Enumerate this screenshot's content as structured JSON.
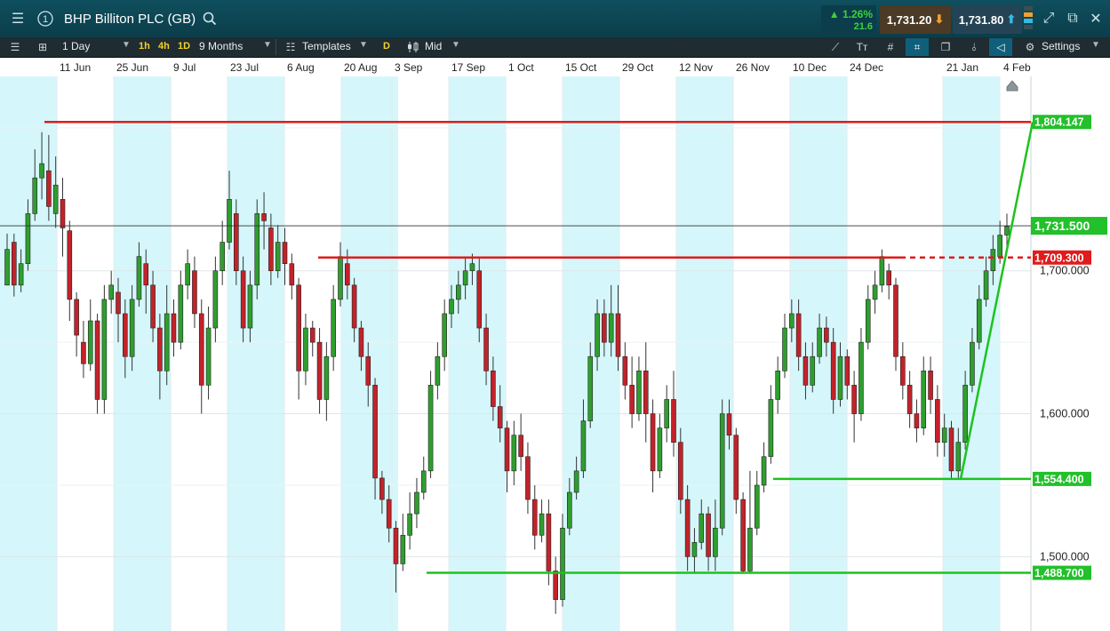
{
  "header": {
    "menu_icon": "hamburger-icon",
    "slot_number": "1",
    "title": "BHP Billiton PLC (GB)",
    "search_icon": "search-icon",
    "change_pct": "▲ 1.26%",
    "change_abs": "21.6",
    "sell_price": "1,731.20",
    "buy_price": "1,731.80",
    "colors": {
      "up": "#3ad43a",
      "sell_bg": "#4a3a26",
      "buy_bg": "#244455"
    }
  },
  "toolbar": {
    "interval": "1 Day",
    "quick_intervals": [
      "1h",
      "4h",
      "1D"
    ],
    "range": "9 Months",
    "templates": "Templates",
    "d_label": "D",
    "price_type": "Mid",
    "settings": "Settings"
  },
  "dates": [
    "11 Jun",
    "25 Jun",
    "9 Jul",
    "23 Jul",
    "6 Aug",
    "20 Aug",
    "3 Sep",
    "17 Sep",
    "1 Oct",
    "15 Oct",
    "29 Oct",
    "12 Nov",
    "26 Nov",
    "10 Dec",
    "24 Dec",
    "21 Jan",
    "4 Feb"
  ],
  "chart_data": {
    "type": "candlestick",
    "y_ticks": [
      "1,700.000",
      "1,600.000",
      "1,500.000"
    ],
    "y_tick_values": [
      1700,
      1600,
      1500
    ],
    "ylim": [
      1448,
      1836
    ],
    "current_price": "1,731.500",
    "current_value": 1731.5,
    "levels": [
      {
        "label": "1,804.147",
        "value": 1804.147,
        "color": "#e01b1b",
        "badge_color": "#22c02a"
      },
      {
        "label": "1,709.300",
        "value": 1709.3,
        "color": "#e01b1b",
        "badge_color": "#e01b1b"
      },
      {
        "label": "1,554.400",
        "value": 1554.4,
        "color": "#1ec21e",
        "badge_color": "#22c02a"
      },
      {
        "label": "1,488.700",
        "value": 1488.7,
        "color": "#1ec21e",
        "badge_color": "#22c02a"
      }
    ],
    "trend_line": {
      "from_value": 1554.4,
      "to_value": 1804.147,
      "color": "#1ec21e"
    },
    "candles": [
      [
        1690,
        1715,
        1700,
        1726
      ],
      [
        1720,
        1690,
        1682,
        1726
      ],
      [
        1690,
        1705,
        1685,
        1715
      ],
      [
        1705,
        1740,
        1700,
        1750
      ],
      [
        1740,
        1765,
        1735,
        1785
      ],
      [
        1765,
        1775,
        1750,
        1797
      ],
      [
        1770,
        1745,
        1735,
        1795
      ],
      [
        1740,
        1760,
        1730,
        1780
      ],
      [
        1750,
        1730,
        1710,
        1765
      ],
      [
        1728,
        1680,
        1665,
        1735
      ],
      [
        1680,
        1655,
        1640,
        1685
      ],
      [
        1650,
        1635,
        1625,
        1665
      ],
      [
        1635,
        1665,
        1630,
        1680
      ],
      [
        1665,
        1610,
        1600,
        1670
      ],
      [
        1610,
        1680,
        1600,
        1690
      ],
      [
        1680,
        1690,
        1670,
        1700
      ],
      [
        1685,
        1670,
        1650,
        1695
      ],
      [
        1670,
        1640,
        1625,
        1680
      ],
      [
        1640,
        1680,
        1630,
        1690
      ],
      [
        1680,
        1710,
        1675,
        1720
      ],
      [
        1705,
        1690,
        1670,
        1715
      ],
      [
        1690,
        1660,
        1650,
        1700
      ],
      [
        1660,
        1630,
        1610,
        1670
      ],
      [
        1630,
        1670,
        1620,
        1690
      ],
      [
        1670,
        1650,
        1640,
        1680
      ],
      [
        1650,
        1690,
        1645,
        1700
      ],
      [
        1690,
        1705,
        1680,
        1715
      ],
      [
        1700,
        1670,
        1660,
        1710
      ],
      [
        1670,
        1620,
        1600,
        1680
      ],
      [
        1620,
        1660,
        1610,
        1675
      ],
      [
        1660,
        1700,
        1650,
        1710
      ],
      [
        1700,
        1720,
        1690,
        1735
      ],
      [
        1720,
        1750,
        1715,
        1770
      ],
      [
        1740,
        1700,
        1690,
        1750
      ],
      [
        1700,
        1660,
        1650,
        1710
      ],
      [
        1660,
        1690,
        1650,
        1700
      ],
      [
        1690,
        1740,
        1680,
        1750
      ],
      [
        1740,
        1735,
        1715,
        1755
      ],
      [
        1730,
        1700,
        1690,
        1740
      ],
      [
        1700,
        1720,
        1695,
        1732
      ],
      [
        1720,
        1705,
        1690,
        1730
      ],
      [
        1705,
        1690,
        1680,
        1712
      ],
      [
        1690,
        1630,
        1610,
        1695
      ],
      [
        1630,
        1660,
        1620,
        1670
      ],
      [
        1660,
        1650,
        1640,
        1665
      ],
      [
        1650,
        1610,
        1600,
        1660
      ],
      [
        1610,
        1640,
        1595,
        1650
      ],
      [
        1640,
        1680,
        1630,
        1690
      ],
      [
        1680,
        1710,
        1675,
        1720
      ],
      [
        1705,
        1690,
        1680,
        1715
      ],
      [
        1690,
        1660,
        1650,
        1695
      ],
      [
        1660,
        1640,
        1630,
        1665
      ],
      [
        1640,
        1620,
        1605,
        1650
      ],
      [
        1620,
        1555,
        1540,
        1625
      ],
      [
        1555,
        1540,
        1530,
        1560
      ],
      [
        1540,
        1520,
        1510,
        1550
      ],
      [
        1520,
        1495,
        1475,
        1525
      ],
      [
        1495,
        1515,
        1490,
        1530
      ],
      [
        1515,
        1530,
        1505,
        1545
      ],
      [
        1530,
        1545,
        1520,
        1555
      ],
      [
        1545,
        1560,
        1540,
        1570
      ],
      [
        1560,
        1620,
        1555,
        1630
      ],
      [
        1620,
        1640,
        1610,
        1650
      ],
      [
        1640,
        1670,
        1630,
        1680
      ],
      [
        1670,
        1680,
        1660,
        1690
      ],
      [
        1680,
        1690,
        1670,
        1700
      ],
      [
        1690,
        1700,
        1680,
        1710
      ],
      [
        1700,
        1705,
        1690,
        1712
      ],
      [
        1700,
        1660,
        1650,
        1710
      ],
      [
        1660,
        1630,
        1620,
        1670
      ],
      [
        1630,
        1605,
        1595,
        1640
      ],
      [
        1605,
        1590,
        1580,
        1620
      ],
      [
        1590,
        1560,
        1545,
        1595
      ],
      [
        1560,
        1585,
        1550,
        1595
      ],
      [
        1585,
        1570,
        1560,
        1600
      ],
      [
        1570,
        1540,
        1530,
        1580
      ],
      [
        1540,
        1515,
        1505,
        1550
      ],
      [
        1515,
        1530,
        1510,
        1540
      ],
      [
        1530,
        1490,
        1480,
        1540
      ],
      [
        1490,
        1470,
        1460,
        1500
      ],
      [
        1470,
        1520,
        1465,
        1530
      ],
      [
        1520,
        1545,
        1515,
        1555
      ],
      [
        1545,
        1560,
        1540,
        1570
      ],
      [
        1560,
        1595,
        1555,
        1610
      ],
      [
        1595,
        1640,
        1590,
        1650
      ],
      [
        1640,
        1670,
        1630,
        1680
      ],
      [
        1670,
        1650,
        1640,
        1680
      ],
      [
        1650,
        1670,
        1640,
        1690
      ],
      [
        1670,
        1640,
        1630,
        1690
      ],
      [
        1640,
        1620,
        1610,
        1650
      ],
      [
        1620,
        1600,
        1590,
        1640
      ],
      [
        1600,
        1630,
        1595,
        1640
      ],
      [
        1630,
        1600,
        1580,
        1650
      ],
      [
        1600,
        1560,
        1545,
        1610
      ],
      [
        1560,
        1590,
        1555,
        1600
      ],
      [
        1590,
        1610,
        1580,
        1620
      ],
      [
        1610,
        1580,
        1570,
        1630
      ],
      [
        1580,
        1540,
        1530,
        1590
      ],
      [
        1540,
        1500,
        1490,
        1550
      ],
      [
        1500,
        1510,
        1488,
        1520
      ],
      [
        1510,
        1530,
        1505,
        1540
      ],
      [
        1530,
        1500,
        1490,
        1535
      ],
      [
        1500,
        1520,
        1490,
        1540
      ],
      [
        1520,
        1600,
        1515,
        1610
      ],
      [
        1600,
        1585,
        1575,
        1610
      ],
      [
        1585,
        1540,
        1530,
        1590
      ],
      [
        1540,
        1490,
        1488,
        1545
      ],
      [
        1490,
        1520,
        1488,
        1560
      ],
      [
        1520,
        1550,
        1515,
        1560
      ],
      [
        1550,
        1570,
        1545,
        1580
      ],
      [
        1570,
        1610,
        1565,
        1620
      ],
      [
        1610,
        1630,
        1600,
        1640
      ],
      [
        1630,
        1660,
        1625,
        1670
      ],
      [
        1660,
        1670,
        1650,
        1680
      ],
      [
        1670,
        1640,
        1630,
        1680
      ],
      [
        1640,
        1620,
        1610,
        1650
      ],
      [
        1620,
        1640,
        1615,
        1650
      ],
      [
        1640,
        1660,
        1635,
        1670
      ],
      [
        1660,
        1650,
        1640,
        1668
      ],
      [
        1650,
        1610,
        1600,
        1660
      ],
      [
        1610,
        1640,
        1605,
        1650
      ],
      [
        1640,
        1620,
        1610,
        1645
      ],
      [
        1620,
        1600,
        1580,
        1630
      ],
      [
        1600,
        1650,
        1595,
        1660
      ],
      [
        1650,
        1680,
        1645,
        1690
      ],
      [
        1680,
        1690,
        1670,
        1700
      ],
      [
        1690,
        1710,
        1685,
        1715
      ],
      [
        1700,
        1690,
        1680,
        1705
      ],
      [
        1690,
        1640,
        1630,
        1695
      ],
      [
        1640,
        1620,
        1610,
        1650
      ],
      [
        1620,
        1600,
        1590,
        1630
      ],
      [
        1600,
        1590,
        1580,
        1610
      ],
      [
        1590,
        1630,
        1585,
        1640
      ],
      [
        1630,
        1610,
        1600,
        1640
      ],
      [
        1610,
        1580,
        1570,
        1620
      ],
      [
        1580,
        1590,
        1570,
        1600
      ],
      [
        1590,
        1560,
        1555,
        1595
      ],
      [
        1560,
        1580,
        1555,
        1590
      ],
      [
        1580,
        1620,
        1575,
        1630
      ],
      [
        1620,
        1650,
        1615,
        1660
      ],
      [
        1650,
        1680,
        1645,
        1690
      ],
      [
        1680,
        1700,
        1675,
        1710
      ],
      [
        1700,
        1715,
        1690,
        1725
      ],
      [
        1710,
        1725,
        1705,
        1735
      ],
      [
        1725,
        1731,
        1715,
        1740
      ]
    ]
  }
}
